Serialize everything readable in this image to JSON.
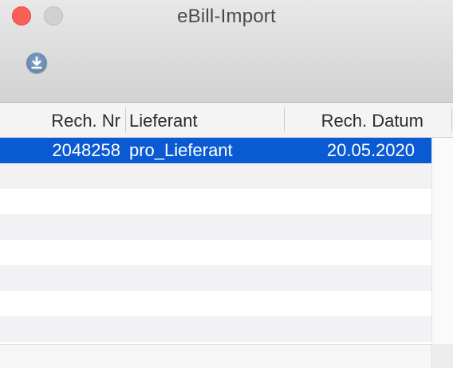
{
  "window": {
    "title": "eBill-Import",
    "buttons": {
      "close_color": "#fc5f57",
      "minimize_color": "#d0d0d0"
    }
  },
  "toolbar": {
    "import_icon": "download-icon"
  },
  "table": {
    "columns": [
      "Rech. Nr",
      "Lieferant",
      "Rech. Datum"
    ],
    "rows": [
      {
        "nr": "2048258",
        "lieferant": "pro_Lieferant",
        "datum": "20.05.2020",
        "selected": true
      }
    ],
    "selection_color": "#0a5bd3"
  }
}
